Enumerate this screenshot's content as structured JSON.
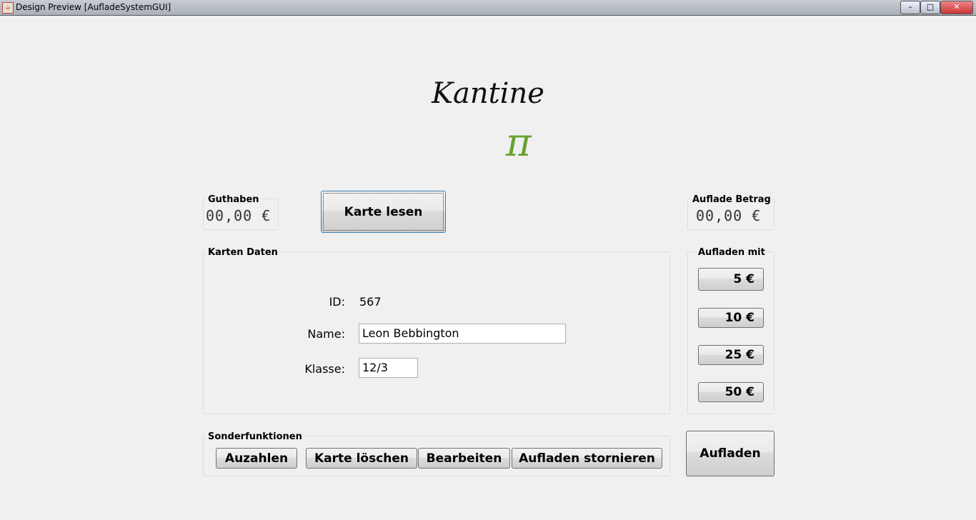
{
  "window": {
    "title": "Design Preview [AufladeSystemGUI]",
    "minimize": "–",
    "maximize": "□",
    "close": "✕"
  },
  "brand": {
    "title": "Kantine",
    "logo_symbol": "π"
  },
  "guthaben": {
    "label": "Guthaben",
    "value": "00,00 €"
  },
  "read_card": {
    "label": "Karte lesen"
  },
  "auflade_betrag": {
    "label": "Auflade Betrag",
    "value": "00,00 €"
  },
  "karten_daten": {
    "label": "Karten Daten",
    "id_label": "ID:",
    "id_value": "567",
    "name_label": "Name:",
    "name_value": "Leon Bebbington",
    "klasse_label": "Klasse:",
    "klasse_value": "12/3"
  },
  "aufladen_mit": {
    "label": "Aufladen mit",
    "amounts": [
      "5 €",
      "10 €",
      "25 €",
      "50 €"
    ]
  },
  "sonder": {
    "label": "Sonderfunktionen",
    "buttons": [
      "Auzahlen",
      "Karte löschen",
      "Bearbeiten",
      "Aufladen stornieren"
    ]
  },
  "aufladen": {
    "label": "Aufladen"
  }
}
